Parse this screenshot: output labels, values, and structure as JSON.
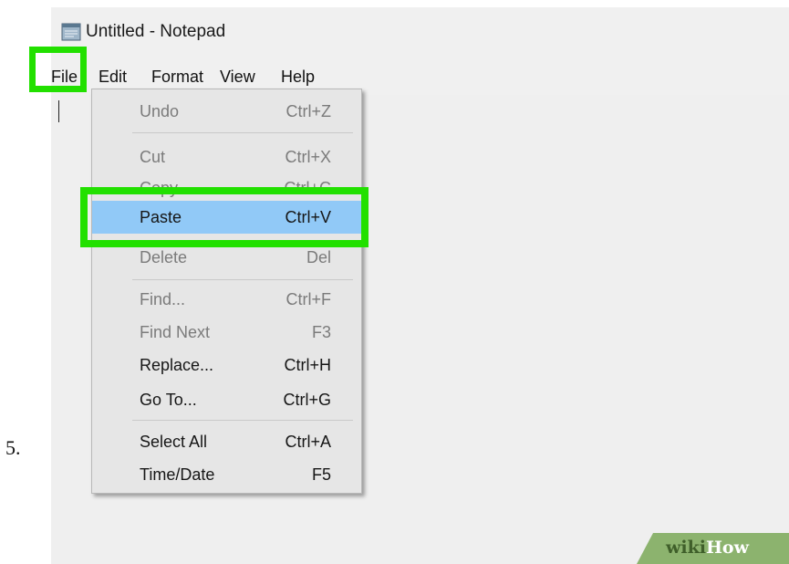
{
  "step_number": "5.",
  "window": {
    "title": "Untitled - Notepad",
    "icon": "notepad-icon"
  },
  "menubar": {
    "file": "File",
    "edit": "Edit",
    "format": "Format",
    "view": "View",
    "help": "Help"
  },
  "edit_menu": {
    "items": [
      {
        "label": "Undo",
        "shortcut": "Ctrl+Z",
        "enabled": false
      },
      {
        "label": "Cut",
        "shortcut": "Ctrl+X",
        "enabled": false
      },
      {
        "label": "Copy",
        "shortcut": "Ctrl+C",
        "enabled": false
      },
      {
        "label": "Paste",
        "shortcut": "Ctrl+V",
        "enabled": true,
        "highlighted": true
      },
      {
        "label": "Delete",
        "shortcut": "Del",
        "enabled": false
      },
      {
        "label": "Find...",
        "shortcut": "Ctrl+F",
        "enabled": false
      },
      {
        "label": "Find Next",
        "shortcut": "F3",
        "enabled": false
      },
      {
        "label": "Replace...",
        "shortcut": "Ctrl+H",
        "enabled": true
      },
      {
        "label": "Go To...",
        "shortcut": "Ctrl+G",
        "enabled": true
      },
      {
        "label": "Select All",
        "shortcut": "Ctrl+A",
        "enabled": true
      },
      {
        "label": "Time/Date",
        "shortcut": "F5",
        "enabled": true
      }
    ]
  },
  "watermark": {
    "wiki": "wiki",
    "how": "How"
  },
  "colors": {
    "highlight_box": "#22e000",
    "menu_hover": "#91c9f7",
    "watermark_bg": "#8cb36e"
  }
}
